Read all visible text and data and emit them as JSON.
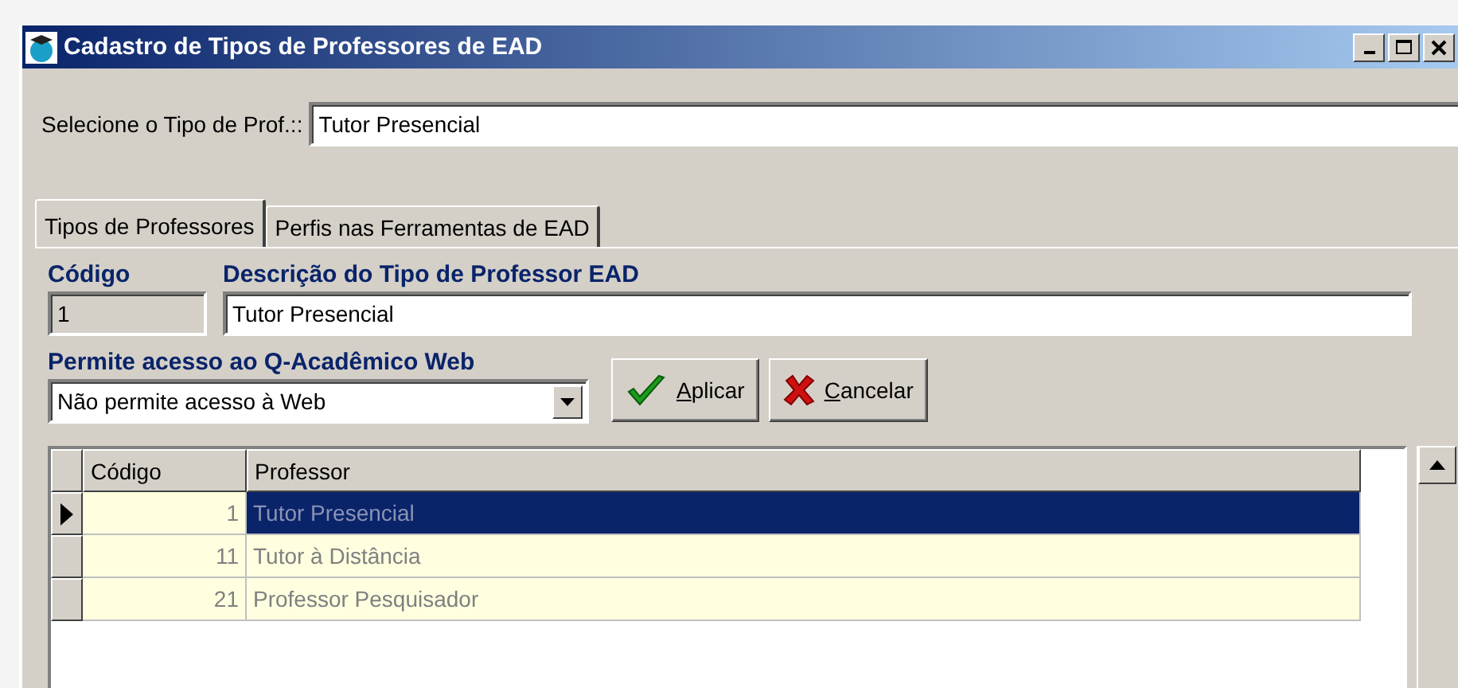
{
  "window": {
    "title": "Cadastro de Tipos de Professores de EAD"
  },
  "selector": {
    "label": "Selecione o Tipo de Prof.::",
    "value": "Tutor Presencial"
  },
  "tabs": [
    {
      "label": "Tipos de Professores",
      "selected": true
    },
    {
      "label": "Perfis nas Ferramentas de EAD",
      "selected": false
    }
  ],
  "form": {
    "code_label": "Código",
    "code_value": "1",
    "description_label": "Descrição do Tipo de Professor EAD",
    "description_value": "Tutor Presencial",
    "access_label": "Permite acesso ao Q-Acadêmico Web",
    "access_value": "Não permite acesso à Web"
  },
  "buttons": [
    {
      "label": "Aplicar",
      "kind": "apply"
    },
    {
      "label": "Cancelar",
      "kind": "cancel"
    }
  ],
  "table": {
    "columns": [
      "Código",
      "Professor"
    ],
    "rows": [
      {
        "code": "1",
        "professor": "Tutor Presencial",
        "selected": true
      },
      {
        "code": "11",
        "professor": "Tutor à Distância",
        "selected": false
      },
      {
        "code": "21",
        "professor": "Professor Pesquisador",
        "selected": false
      }
    ]
  }
}
